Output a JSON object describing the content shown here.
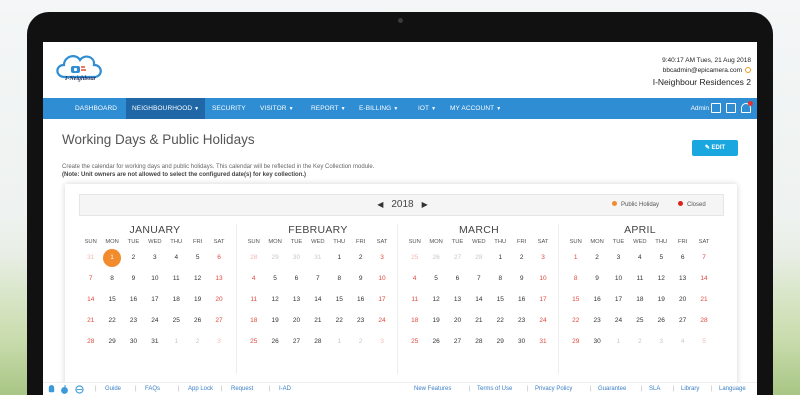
{
  "header": {
    "logo_text": "I-Neighbour",
    "datetime": "9:40:17 AM Tues, 21 Aug 2018",
    "email": "bbcadmin@epicamera.com",
    "site": "I-Neighbour Residences 2"
  },
  "nav": {
    "items": [
      {
        "label": "Dashboard",
        "caret": false
      },
      {
        "label": "Neighbourhood",
        "caret": true
      },
      {
        "label": "Security",
        "caret": false
      },
      {
        "label": "Visitor",
        "caret": true
      },
      {
        "label": "Report",
        "caret": true
      },
      {
        "label": "E-Billing",
        "caret": true
      },
      {
        "label": "IOT",
        "caret": true
      },
      {
        "label": "My Account",
        "caret": true
      }
    ],
    "user": "Admin"
  },
  "page": {
    "title": "Working Days & Public Holidays",
    "edit_label": "EDIT",
    "description": "Create the calendar for working days and public holidays. This calendar will be reflected in the Key Collection module.",
    "note": "(Note: Unit owners are not allowed to select the configured date(s) for key collection.)"
  },
  "calendar": {
    "year": "2018",
    "legend": [
      {
        "label": "Public Holiday",
        "color": "#f28b2c"
      },
      {
        "label": "Closed",
        "color": "#d9231c"
      }
    ],
    "weekdays": [
      "SUN",
      "MON",
      "TUE",
      "WED",
      "THU",
      "FRI",
      "SAT"
    ],
    "months": [
      {
        "name": "JANUARY",
        "days": [
          "31",
          "1",
          "2",
          "3",
          "4",
          "5",
          "6",
          "7",
          "8",
          "9",
          "10",
          "11",
          "12",
          "13",
          "14",
          "15",
          "16",
          "17",
          "18",
          "19",
          "20",
          "21",
          "22",
          "23",
          "24",
          "25",
          "26",
          "27",
          "28",
          "29",
          "30",
          "31",
          "1",
          "2",
          "3"
        ],
        "lead": 1,
        "trail": 3,
        "holiday": "1"
      },
      {
        "name": "FEBRUARY",
        "days": [
          "28",
          "29",
          "30",
          "31",
          "1",
          "2",
          "3",
          "4",
          "5",
          "6",
          "7",
          "8",
          "9",
          "10",
          "11",
          "12",
          "13",
          "14",
          "15",
          "16",
          "17",
          "18",
          "19",
          "20",
          "21",
          "22",
          "23",
          "24",
          "25",
          "26",
          "27",
          "28",
          "1",
          "2",
          "3"
        ],
        "lead": 4,
        "trail": 3,
        "holiday": ""
      },
      {
        "name": "MARCH",
        "days": [
          "25",
          "26",
          "27",
          "28",
          "1",
          "2",
          "3",
          "4",
          "5",
          "6",
          "7",
          "8",
          "9",
          "10",
          "11",
          "12",
          "13",
          "14",
          "15",
          "16",
          "17",
          "18",
          "19",
          "20",
          "21",
          "22",
          "23",
          "24",
          "25",
          "26",
          "27",
          "28",
          "29",
          "30",
          "31"
        ],
        "lead": 4,
        "trail": 0,
        "holiday": ""
      },
      {
        "name": "APRIL",
        "days": [
          "1",
          "2",
          "3",
          "4",
          "5",
          "6",
          "7",
          "8",
          "9",
          "10",
          "11",
          "12",
          "13",
          "14",
          "15",
          "16",
          "17",
          "18",
          "19",
          "20",
          "21",
          "22",
          "23",
          "24",
          "25",
          "26",
          "27",
          "28",
          "29",
          "30",
          "1",
          "2",
          "3",
          "4",
          "5"
        ],
        "lead": 0,
        "trail": 5,
        "holiday": ""
      }
    ]
  },
  "footer": {
    "links": [
      "Guide",
      "FAQs",
      "App Lock",
      "Request",
      "I-AD"
    ],
    "right_links": [
      "New Features",
      "Terms of Use",
      "Privacy Policy",
      "Guarantee",
      "SLA",
      "Library",
      "Language"
    ]
  },
  "colors": {
    "nav": "#2e8dd3",
    "accent": "#1aa6de",
    "holiday": "#f28b2c",
    "closed": "#d9231c"
  }
}
